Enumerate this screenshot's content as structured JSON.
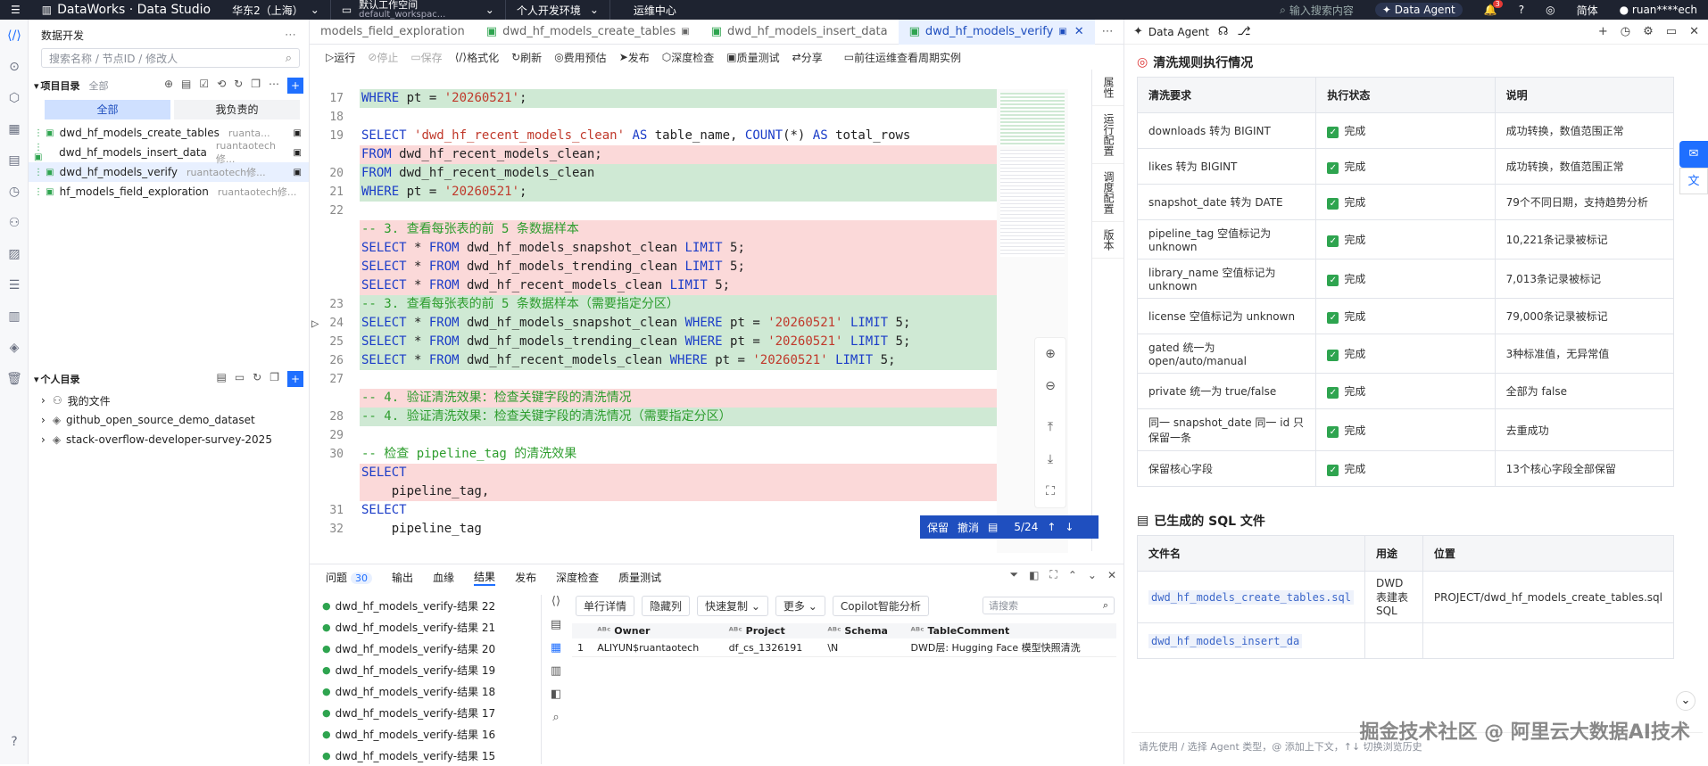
{
  "topbar": {
    "app": "DataWorks · Data Studio",
    "region": "华东2（上海）",
    "workspace": "默认工作空间",
    "workspace_sub": "default_workspac...",
    "env": "个人开发环境",
    "ops": "运维中心",
    "search_placeholder": "输入搜索内容",
    "agent": "Data Agent",
    "notif_count": "3",
    "lang": "简体",
    "user": "ruan****ech"
  },
  "sidebar": {
    "title": "数据开发",
    "search_placeholder": "搜索名称 / 节点ID / 修改人",
    "project_dir": "项目目录",
    "project_scope": "全部",
    "filter_all": "全部",
    "filter_mine": "我负责的",
    "files": [
      {
        "name": "dwd_hf_models_create_tables",
        "owner": "ruanta..."
      },
      {
        "name": "dwd_hf_models_insert_data",
        "owner": "ruantaotech修..."
      },
      {
        "name": "dwd_hf_models_verify",
        "owner": "ruantaotech修..."
      },
      {
        "name": "hf_models_field_exploration",
        "owner": "ruantaotech修..."
      }
    ],
    "personal_dir": "个人目录",
    "personal": [
      {
        "name": "我的文件"
      },
      {
        "name": "github_open_source_demo_dataset"
      },
      {
        "name": "stack-overflow-developer-survey-2025"
      }
    ]
  },
  "tabs": [
    {
      "label": "models_field_exploration"
    },
    {
      "label": "dwd_hf_models_create_tables"
    },
    {
      "label": "dwd_hf_models_insert_data"
    },
    {
      "label": "dwd_hf_models_verify"
    }
  ],
  "toolbar": [
    "运行",
    "停止",
    "保存",
    "格式化",
    "刷新",
    "费用预估",
    "发布",
    "深度检查",
    "质量测试",
    "分享",
    "前往运维查看周期实例"
  ],
  "side_tabs": [
    "属性",
    "运行配置",
    "调度配置",
    "版本"
  ],
  "code": [
    {
      "ln": "17",
      "t": "WHERE pt = '20260521';",
      "c": "add"
    },
    {
      "ln": "18",
      "t": "",
      "c": ""
    },
    {
      "ln": "19",
      "t": "SELECT 'dwd_hf_recent_models_clean' AS table_name, COUNT(*) AS total_rows",
      "c": ""
    },
    {
      "ln": "",
      "t": "FROM dwd_hf_recent_models_clean;",
      "c": "del"
    },
    {
      "ln": "20",
      "t": "FROM dwd_hf_recent_models_clean",
      "c": "add"
    },
    {
      "ln": "21",
      "t": "WHERE pt = '20260521';",
      "c": "add"
    },
    {
      "ln": "22",
      "t": "",
      "c": ""
    },
    {
      "ln": "",
      "t": "-- 3. 查看每张表的前 5 条数据样本",
      "c": "del"
    },
    {
      "ln": "",
      "t": "SELECT * FROM dwd_hf_models_snapshot_clean LIMIT 5;",
      "c": "del"
    },
    {
      "ln": "",
      "t": "SELECT * FROM dwd_hf_models_trending_clean LIMIT 5;",
      "c": "del"
    },
    {
      "ln": "",
      "t": "SELECT * FROM dwd_hf_recent_models_clean LIMIT 5;",
      "c": "del"
    },
    {
      "ln": "23",
      "t": "-- 3. 查看每张表的前 5 条数据样本（需要指定分区）",
      "c": "add"
    },
    {
      "ln": "24",
      "t": "SELECT * FROM dwd_hf_models_snapshot_clean WHERE pt = '20260521' LIMIT 5;",
      "c": "add"
    },
    {
      "ln": "25",
      "t": "SELECT * FROM dwd_hf_models_trending_clean WHERE pt = '20260521' LIMIT 5;",
      "c": "add"
    },
    {
      "ln": "26",
      "t": "SELECT * FROM dwd_hf_recent_models_clean WHERE pt = '20260521' LIMIT 5;",
      "c": "add"
    },
    {
      "ln": "27",
      "t": "",
      "c": ""
    },
    {
      "ln": "",
      "t": "-- 4. 验证清洗效果：检查关键字段的清洗情况",
      "c": "del"
    },
    {
      "ln": "28",
      "t": "-- 4. 验证清洗效果：检查关键字段的清洗情况（需要指定分区）",
      "c": "add"
    },
    {
      "ln": "29",
      "t": "",
      "c": ""
    },
    {
      "ln": "30",
      "t": "-- 检查 pipeline_tag 的清洗效果",
      "c": ""
    },
    {
      "ln": "",
      "t": "SELECT",
      "c": "del"
    },
    {
      "ln": "",
      "t": "    pipeline_tag,",
      "c": "del"
    },
    {
      "ln": "31",
      "t": "SELECT",
      "c": ""
    },
    {
      "ln": "32",
      "t": "    pipeline_tag",
      "c": ""
    }
  ],
  "diffbar": {
    "keep": "保留",
    "undo": "撤消",
    "pos": "5/24"
  },
  "bottom": {
    "tabs": [
      "问题",
      "输出",
      "血缘",
      "结果",
      "发布",
      "深度检查",
      "质量测试"
    ],
    "issues": "30",
    "results": [
      "dwd_hf_models_verify-结果 22",
      "dwd_hf_models_verify-结果 21",
      "dwd_hf_models_verify-结果 20",
      "dwd_hf_models_verify-结果 19",
      "dwd_hf_models_verify-结果 18",
      "dwd_hf_models_verify-结果 17",
      "dwd_hf_models_verify-结果 16",
      "dwd_hf_models_verify-结果 15"
    ],
    "actions": [
      "单行详情",
      "隐藏列",
      "快速复制",
      "更多",
      "Copilot智能分析"
    ],
    "search_placeholder": "请搜索",
    "cols": [
      "Owner",
      "Project",
      "Schema",
      "TableComment"
    ],
    "row": [
      "1",
      "ALIYUN$ruantaotech",
      "df_cs_1326191",
      "\\N",
      "DWD层: Hugging Face 模型快照清洗"
    ]
  },
  "agent": {
    "title": "Data Agent",
    "sec1": "清洗规则执行情况",
    "t1_head": [
      "清洗要求",
      "执行状态",
      "说明"
    ],
    "t1_rows": [
      [
        "downloads 转为 BIGINT",
        "完成",
        "成功转换，数值范围正常"
      ],
      [
        "likes 转为 BIGINT",
        "完成",
        "成功转换，数值范围正常"
      ],
      [
        "snapshot_date 转为 DATE",
        "完成",
        "79个不同日期，支持趋势分析"
      ],
      [
        "pipeline_tag 空值标记为 unknown",
        "完成",
        "10,221条记录被标记"
      ],
      [
        "library_name 空值标记为 unknown",
        "完成",
        "7,013条记录被标记"
      ],
      [
        "license 空值标记为 unknown",
        "完成",
        "79,000条记录被标记"
      ],
      [
        "gated 统一为 open/auto/manual",
        "完成",
        "3种标准值，无异常值"
      ],
      [
        "private 统一为 true/false",
        "完成",
        "全部为 false"
      ],
      [
        "同一 snapshot_date 同一 id 只保留一条",
        "完成",
        "去重成功"
      ],
      [
        "保留核心字段",
        "完成",
        "13个核心字段全部保留"
      ]
    ],
    "sec2": "已生成的 SQL 文件",
    "t2_head": [
      "文件名",
      "用途",
      "位置"
    ],
    "t2_rows": [
      [
        "dwd_hf_models_create_tables.sql",
        "DWD 表建表 SQL",
        "PROJECT/dwd_hf_models_create_tables.sql"
      ],
      [
        "dwd_hf_models_insert_da",
        "",
        ""
      ]
    ],
    "input_placeholder": "请先使用 / 选择 Agent 类型，@ 添加上下文，↑↓ 切换浏览历史",
    "watermark": "掘金技术社区 @ 阿里云大数据AI技术"
  }
}
